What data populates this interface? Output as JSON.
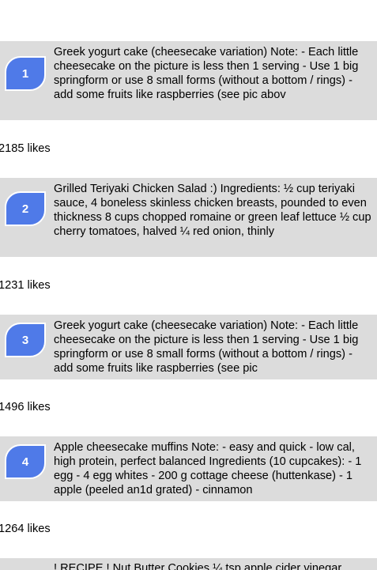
{
  "recipes": [
    {
      "rank": "1",
      "text": "Greek yogurt cake (cheesecake variation) Note: - Each little cheesecake on the picture is less then 1 serving - Use 1 big springform or use 8 small forms (without a bottom / rings) - add some fruits like raspberries (see pic abov",
      "likes": "2185 likes"
    },
    {
      "rank": "2",
      "text": "Grilled Teriyaki Chicken Salad :) Ingredients: ½ cup teriyaki sauce, 4 boneless skinless chicken breasts, pounded to even thickness 8 cups chopped romaine or green leaf lettuce ½ cup cherry tomatoes, halved ¼ red onion, thinly",
      "likes": "1231 likes"
    },
    {
      "rank": "3",
      "text": "Greek yogurt cake (cheesecake variation) Note: - Each little cheesecake on the picture is less then 1 serving - Use 1 big springform or use 8 small forms (without a bottom / rings) - add some fruits like raspberries (see pic",
      "likes": "1496 likes"
    },
    {
      "rank": "4",
      "text": "Apple cheesecake muffins Note: - easy and quick - low cal, high protein, perfect balanced Ingredients (10 cupcakes): - 1 egg - 4 egg whites - 200 g cottage cheese (huttenkase) - 1 apple (peeled an1d grated) - cinnamon",
      "likes": "1264 likes"
    },
    {
      "rank": "",
      "text": "! RECIPE ! Nut Butter Cookies ¼ tsp apple cider vinegar",
      "likes": ""
    }
  ],
  "colors": {
    "card_background": "#dcdcdc",
    "badge_fill": "#4f7ae8",
    "badge_border": "#ffffff"
  }
}
